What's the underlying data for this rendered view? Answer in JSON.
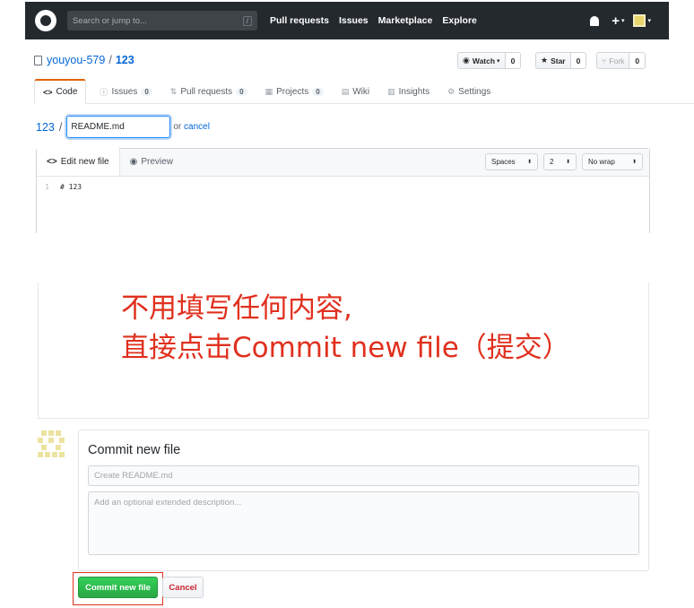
{
  "header": {
    "search_placeholder": "Search or jump to...",
    "search_key": "/",
    "nav": [
      "Pull requests",
      "Issues",
      "Marketplace",
      "Explore"
    ],
    "plus": "+",
    "caret": "▾"
  },
  "repo": {
    "owner": "youyou-579",
    "separator": "/",
    "name": "123",
    "watch_label": "Watch",
    "watch_caret": "▾",
    "watch_count": "0",
    "star_label": "Star",
    "star_count": "0",
    "fork_label": "Fork",
    "fork_count": "0"
  },
  "tabs": [
    {
      "label": "Code",
      "icon": "<>",
      "count": ""
    },
    {
      "label": "Issues",
      "icon": "ⓘ",
      "count": "0"
    },
    {
      "label": "Pull requests",
      "icon": "⇅",
      "count": "0"
    },
    {
      "label": "Projects",
      "icon": "▦",
      "count": "0"
    },
    {
      "label": "Wiki",
      "icon": "▤",
      "count": ""
    },
    {
      "label": "Insights",
      "icon": "▥",
      "count": ""
    },
    {
      "label": "Settings",
      "icon": "⚙",
      "count": ""
    }
  ],
  "path": {
    "repo": "123",
    "slash": "/",
    "filename": "README.md",
    "or": "or",
    "cancel": "cancel"
  },
  "editor": {
    "tab_edit": "Edit new file",
    "tab_edit_icon": "<>",
    "tab_preview": "Preview",
    "tab_preview_icon": "◉",
    "indent_mode": "Spaces",
    "indent_size": "2",
    "wrap_mode": "No wrap",
    "select_arrow": "⬍",
    "line_number": "1",
    "line_content": "# 123"
  },
  "annotation": {
    "line1": "不用填写任何内容,",
    "line2": "直接点击Commit new file（提交）"
  },
  "commit": {
    "title": "Commit new file",
    "summary_placeholder": "Create README.md",
    "description_placeholder": "Add an optional extended description...",
    "commit_button": "Commit new file",
    "cancel_button": "Cancel"
  },
  "colors": {
    "header_bg": "#24292e",
    "link": "#0366d6",
    "annotation": "#e0301e",
    "commit_green": "#28a745",
    "cancel_red": "#cb2431",
    "active_tab_border": "#e36209"
  }
}
